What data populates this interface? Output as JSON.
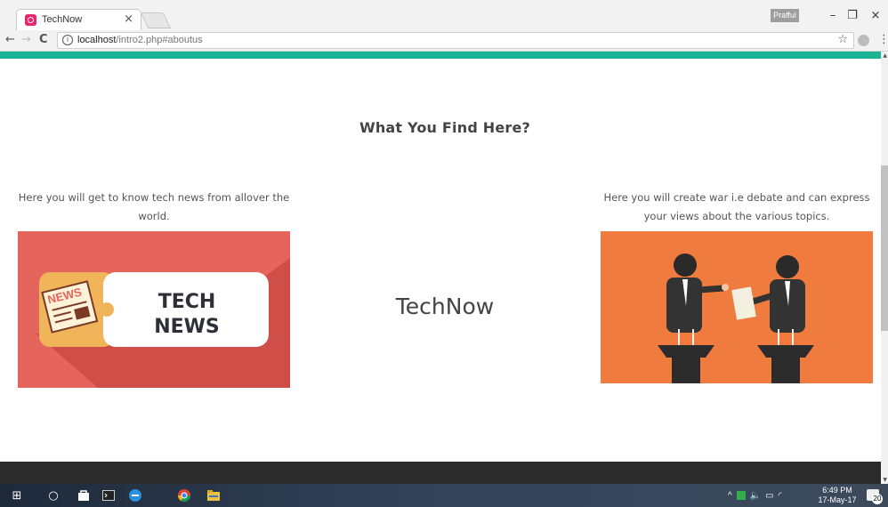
{
  "browser": {
    "tab_title": "TechNow",
    "tab_close": "×",
    "profile_label": "Prafful",
    "window_controls": {
      "minimize": "–",
      "maximize": "❐",
      "close": "×"
    },
    "nav": {
      "back": "←",
      "forward": "→",
      "reload": "C"
    },
    "url_host": "localhost",
    "url_path": "/intro2.php#aboutus",
    "star": "☆",
    "menu": "⋮"
  },
  "page": {
    "accent_color": "#1ab394",
    "section_title": "What You Find Here?",
    "left_text": "Here you will get to know tech news from allover the world.",
    "right_text": "Here you will create war i.e debate and can express your views about the various topics.",
    "brand": "TechNow",
    "news_image": {
      "badge": "NEWS",
      "line1": "TECH",
      "line2": "NEWS"
    }
  },
  "taskbar": {
    "start_icon": "⊞",
    "search_icon": "○",
    "tray_arrow": "^",
    "clock_time": "6:49 PM",
    "clock_date": "17-May-17",
    "notification_count": "20"
  }
}
